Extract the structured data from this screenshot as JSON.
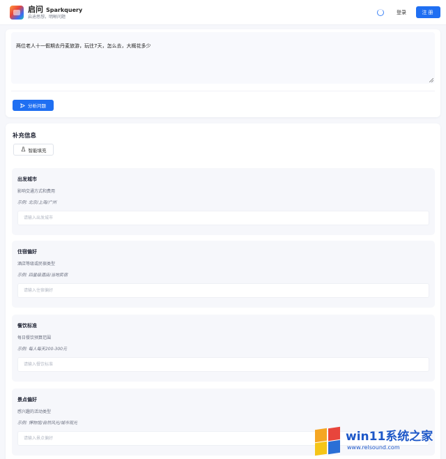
{
  "header": {
    "brand_cn": "启问",
    "brand_en": "Sparkquery",
    "tagline": "启迪思想，明晰问题",
    "login_label": "登录",
    "register_label": "注册"
  },
  "question": {
    "text": "两位老人十一假期去丹麦旅游，玩往7天，怎么去，大概花多少",
    "analyze_label": "分析问题"
  },
  "supplement": {
    "title": "补充信息",
    "smart_fill_label": "智能填充",
    "fields": [
      {
        "title": "出发城市",
        "desc": "影响交通方式和费用",
        "example": "示例: 北京/上海/广州",
        "placeholder": "请输入出发城市",
        "value": ""
      },
      {
        "title": "住宿偏好",
        "desc": "酒店等级或民宿类型",
        "example": "示例: 四星级酒店/当地民宿",
        "placeholder": "请输入住宿偏好",
        "value": ""
      },
      {
        "title": "餐饮标准",
        "desc": "每日餐饮预算范围",
        "example": "示例: 每人每天200-300元",
        "placeholder": "请输入餐饮标准",
        "value": ""
      },
      {
        "title": "景点偏好",
        "desc": "感兴趣的活动类型",
        "example": "示例: 博物馆/自然风光/城市观光",
        "placeholder": "请输入景点偏好",
        "value": ""
      }
    ]
  },
  "watermark": {
    "main": "win11系统之家",
    "url": "www.relsound.com"
  },
  "colors": {
    "primary": "#1f6ff2",
    "page_bg": "#f6f7fb",
    "card_bg": "#ffffff",
    "watermark_blue": "#1e58c8"
  },
  "icons": {
    "logo": "app-logo-icon",
    "spinner": "loading-circle-icon",
    "analyze": "send-icon",
    "smart_fill": "flask-icon",
    "resize": "resize-handle-icon",
    "watermark_logo": "windows-logo-icon"
  }
}
